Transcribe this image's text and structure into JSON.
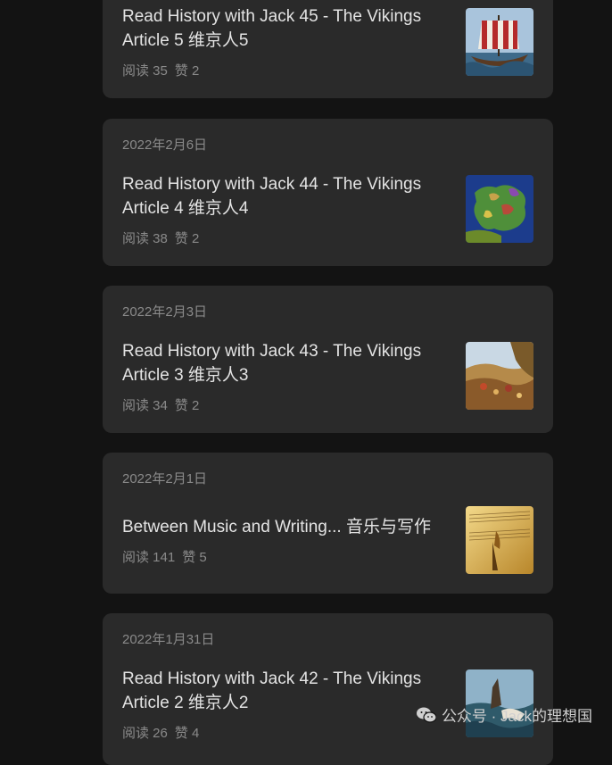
{
  "articles": [
    {
      "title_line1": "Read History with Jack 45 - The Vikings",
      "title_line2": "Article 5 维京人5",
      "reads": "阅读 35",
      "likes": "赞 2",
      "thumb": "viking-ship"
    },
    {
      "date": "2022年2月6日",
      "title_line1": "Read History with Jack 44 - The Vikings",
      "title_line2": "Article 4 维京人4",
      "reads": "阅读 38",
      "likes": "赞 2",
      "thumb": "europe-map"
    },
    {
      "date": "2022年2月3日",
      "title_line1": "Read History with Jack 43 - The Vikings",
      "title_line2": "Article 3 维京人3",
      "reads": "阅读 34",
      "likes": "赞 2",
      "thumb": "battle-painting"
    },
    {
      "date": "2022年2月1日",
      "title_line1": "Between Music and Writing... 音乐与写作",
      "reads": "阅读 141",
      "likes": "赞 5",
      "thumb": "sheet-music"
    },
    {
      "date": "2022年1月31日",
      "title_line1": "Read History with Jack 42 - The Vikings",
      "title_line2": "Article 2 维京人2",
      "reads": "阅读 26",
      "likes": "赞 4",
      "thumb": "sea-painting"
    }
  ],
  "watermark": {
    "text": "公众号 · Jack的理想国",
    "icon": "wechat-icon"
  }
}
